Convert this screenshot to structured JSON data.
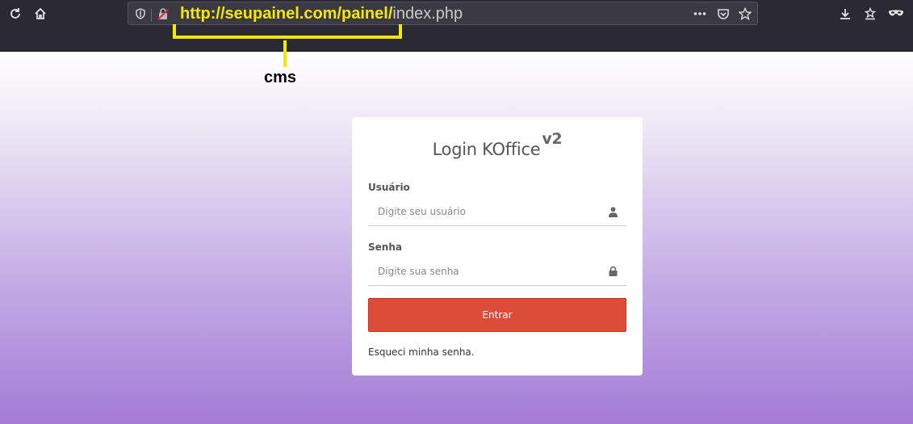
{
  "browser": {
    "url_highlight": "http://seupainel.com/painel/",
    "url_rest": "index.php",
    "icons": [
      "reload-icon",
      "home-icon",
      "shield-icon",
      "insecure-lock-icon",
      "more-icon",
      "pocket-icon",
      "bookmark-star-icon",
      "download-icon",
      "library-icon",
      "private-mask-icon"
    ]
  },
  "annotation": {
    "label": "cms",
    "color": "#f5e800"
  },
  "login": {
    "title": "Login KOffice",
    "version": "v2",
    "username_label": "Usuário",
    "username_placeholder": "Digite seu usuário",
    "password_label": "Senha",
    "password_placeholder": "Digite sua senha",
    "submit_label": "Entrar",
    "submit_color": "#dd4b39",
    "forgot_label": "Esqueci minha senha."
  }
}
